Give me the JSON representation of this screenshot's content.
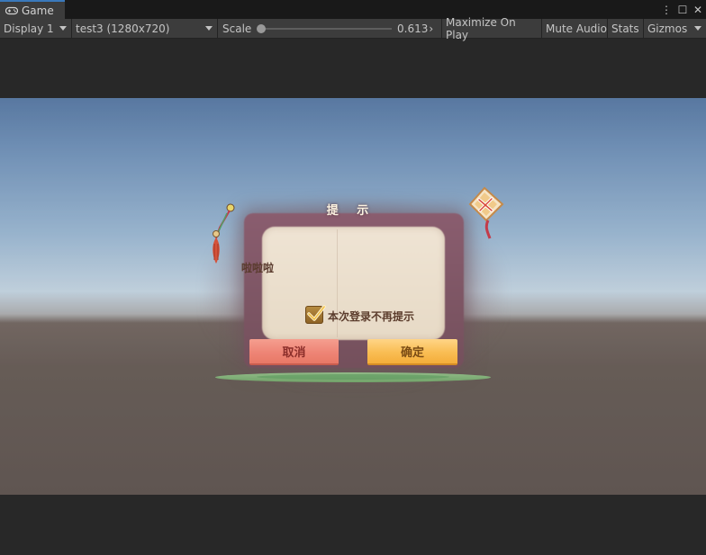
{
  "tab": {
    "title": "Game",
    "menu_glyph": "⋮",
    "maximize_glyph": "☐",
    "close_glyph": "✕"
  },
  "toolbar": {
    "display": "Display 1",
    "resolution": "test3 (1280x720)",
    "scale_label": "Scale",
    "scale_value": "0.613",
    "scale_value_level": 0.613,
    "maximize_on_play": "Maximize On Play",
    "mute_audio": "Mute Audio",
    "stats": "Stats",
    "gizmos": "Gizmos"
  },
  "dialog": {
    "title": "提 示",
    "message": "啦啦啦",
    "checkbox_label": "本次登录不再提示",
    "checkbox_checked": true,
    "cancel_label": "取消",
    "confirm_label": "确定"
  },
  "colors": {
    "editor_bg": "#282828",
    "toolbar_bg": "#3c3c3c",
    "tab_accent": "#3a79bb",
    "cancel_button": "#ee8576",
    "confirm_button": "#f9bd53",
    "panel": "#7f5766"
  },
  "icons": {
    "tab": "gamepad-icon",
    "close_dialog": "kite-close-icon",
    "decoration": "tassel-ornament-icon",
    "checkbox": "checkmark-icon"
  }
}
